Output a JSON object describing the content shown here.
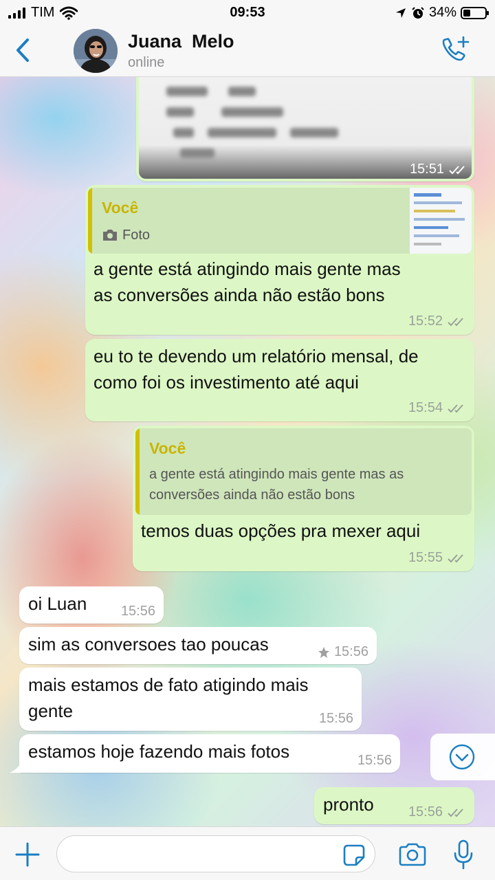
{
  "status_bar": {
    "carrier": "TIM",
    "time": "09:53",
    "battery_percent_text": "34%",
    "battery_level": 0.34
  },
  "header": {
    "contact_name": "Juana  Melo",
    "contact_status": "online"
  },
  "messages": [
    {
      "direction": "out",
      "type": "image",
      "time": "15:51"
    },
    {
      "direction": "out",
      "quote_author": "Você",
      "quote_text": "Foto",
      "text": "a gente está atingindo mais gente mas\nas conversões ainda não estão bons",
      "time": "15:52"
    },
    {
      "direction": "out",
      "text": "eu to te devendo um relatório mensal, de\ncomo foi os investimento até aqui",
      "time": "15:54"
    },
    {
      "direction": "out",
      "quote_author": "Você",
      "quote_text": "a gente está atingindo mais gente mas as\nconversões ainda não estão bons",
      "text": "temos duas opções pra mexer aqui",
      "time": "15:55"
    },
    {
      "direction": "in",
      "text": "oi Luan",
      "time": "15:56"
    },
    {
      "direction": "in",
      "text": "sim as conversoes tao poucas",
      "time": "15:56",
      "starred": true
    },
    {
      "direction": "in",
      "text": "mais estamos de fato atigindo mais\ngente",
      "time": "15:56"
    },
    {
      "direction": "in",
      "text": "estamos hoje fazendo mais fotos",
      "time": "15:56"
    },
    {
      "direction": "out",
      "text": "pronto",
      "time": "15:56"
    }
  ],
  "colors": {
    "accent": "#1a7ec2",
    "outgoing_bubble": "#dcf7c5",
    "incoming_bubble": "#ffffff",
    "quote_author": "#c9b500"
  },
  "icons": {
    "back": "chevron-left-icon",
    "call_add": "phone-plus-icon",
    "plus": "plus-icon",
    "sticker": "sticker-icon",
    "camera": "camera-icon",
    "mic": "microphone-icon",
    "scroll_down": "chevron-down-circle-icon",
    "star": "star-icon",
    "read_ticks": "double-check-icon"
  }
}
